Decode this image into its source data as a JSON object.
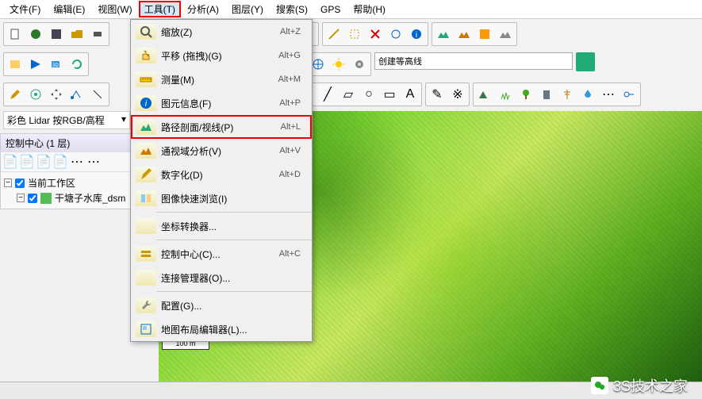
{
  "menubar": {
    "items": [
      "文件(F)",
      "编辑(E)",
      "视图(W)",
      "工具(T)",
      "分析(A)",
      "图层(Y)",
      "搜索(S)",
      "GPS",
      "帮助(H)"
    ],
    "highlighted_index": 3
  },
  "toolbar2_input": "创建等高线",
  "layer_dropdown": "彩色 Lidar 按RGB/高程",
  "panel": {
    "title": "控制中心 (1 层)",
    "tree": {
      "root": "当前工作区",
      "items": [
        "干塘子水库_dsm"
      ]
    }
  },
  "tools_menu": [
    {
      "label": "缩放(Z)",
      "shortcut": "Alt+Z",
      "icon": "zoom"
    },
    {
      "label": "平移 (拖拽)(G)",
      "shortcut": "Alt+G",
      "icon": "pan"
    },
    {
      "label": "测量(M)",
      "shortcut": "Alt+M",
      "icon": "measure"
    },
    {
      "label": "图元信息(F)",
      "shortcut": "Alt+P",
      "icon": "info"
    },
    {
      "label": "路径剖面/视线(P)",
      "shortcut": "Alt+L",
      "icon": "profile",
      "highlight": true
    },
    {
      "label": "通视域分析(V)",
      "shortcut": "Alt+V",
      "icon": "viewshed"
    },
    {
      "label": "数字化(D)",
      "shortcut": "Alt+D",
      "icon": "digitize"
    },
    {
      "label": "图像快速浏览(I)",
      "shortcut": "",
      "icon": "swipe"
    },
    {
      "sep": true
    },
    {
      "label": "坐标转换器...",
      "shortcut": "",
      "icon": ""
    },
    {
      "sep": true
    },
    {
      "label": "控制中心(C)...",
      "shortcut": "Alt+C",
      "icon": "ctrl"
    },
    {
      "label": "连接管理器(O)...",
      "shortcut": "",
      "icon": ""
    },
    {
      "sep": true
    },
    {
      "label": "配置(G)...",
      "shortcut": "",
      "icon": "wrench"
    },
    {
      "label": "地图布局编辑器(L)...",
      "shortcut": "",
      "icon": "layout"
    }
  ],
  "scale_bar": "100 m",
  "watermark": "3S技术之家"
}
